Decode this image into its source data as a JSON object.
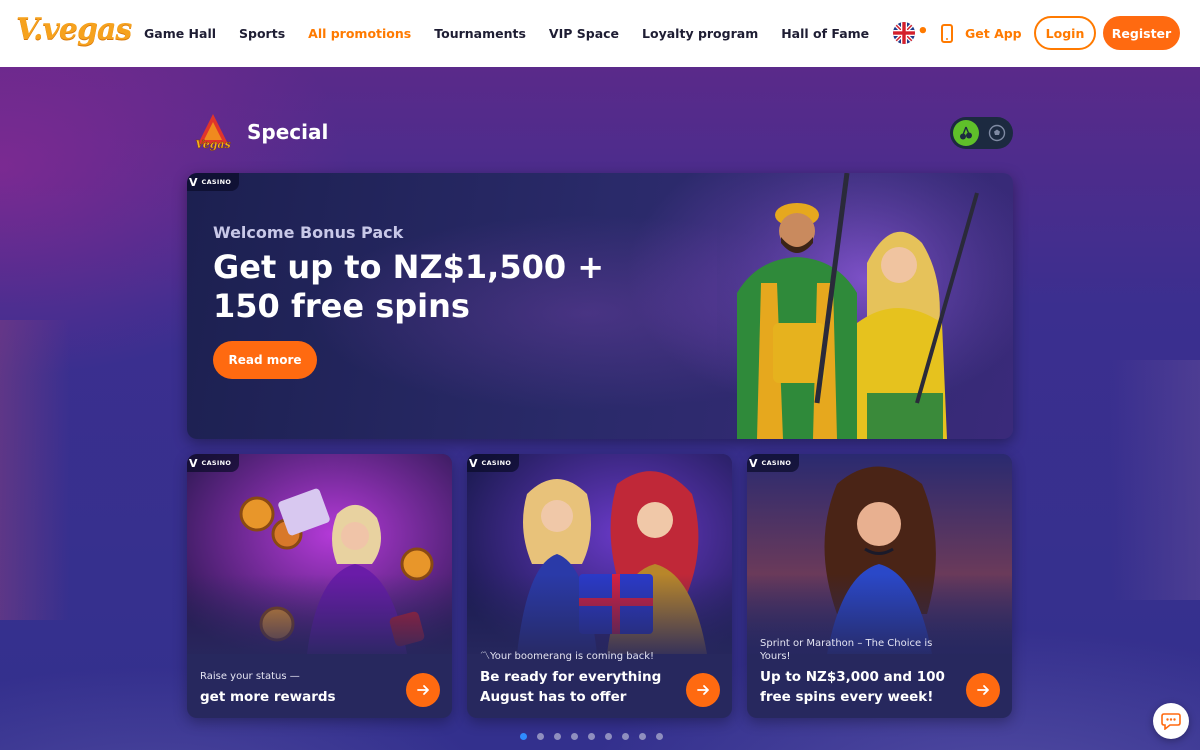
{
  "header": {
    "logo_text": "V.vegas",
    "nav": [
      {
        "label": "Game Hall",
        "active": false
      },
      {
        "label": "Sports",
        "active": false
      },
      {
        "label": "All promotions",
        "active": true
      },
      {
        "label": "Tournaments",
        "active": false
      },
      {
        "label": "VIP Space",
        "active": false
      },
      {
        "label": "Loyalty program",
        "active": false
      },
      {
        "label": "Hall of Fame",
        "active": false
      }
    ],
    "more_label": "•••",
    "language_icon": "uk-flag-icon",
    "get_app_label": "Get App",
    "login_label": "Login",
    "register_label": "Register"
  },
  "section": {
    "logo_text": "Vegas",
    "title": "Special",
    "toggle": {
      "casino_icon": "cherries-icon",
      "sports_icon": "soccer-ball-icon",
      "selected": "casino"
    }
  },
  "hero": {
    "tag": "CASINO",
    "kicker": "Welcome Bonus Pack",
    "title": "Get up to NZ$1,500 + 150 free spins",
    "button_label": "Read more"
  },
  "cards": [
    {
      "tag": "CASINO",
      "subtitle": "Raise your status —",
      "title": "get more rewards"
    },
    {
      "tag": "CASINO",
      "subtitle": "〽Your boomerang is coming back!",
      "title": "Be ready for everything August has to offer"
    },
    {
      "tag": "CASINO",
      "subtitle": "Sprint or Marathon – The Choice is Yours!",
      "title": "Up to NZ$3,000 and 100 free spins every week!"
    }
  ],
  "pagination": {
    "total": 9,
    "active_index": 0
  },
  "colors": {
    "accent": "#ff7a00",
    "button": "#ff6a10",
    "toggle_on": "#5fc02a",
    "dot_active": "#2f8bff"
  }
}
